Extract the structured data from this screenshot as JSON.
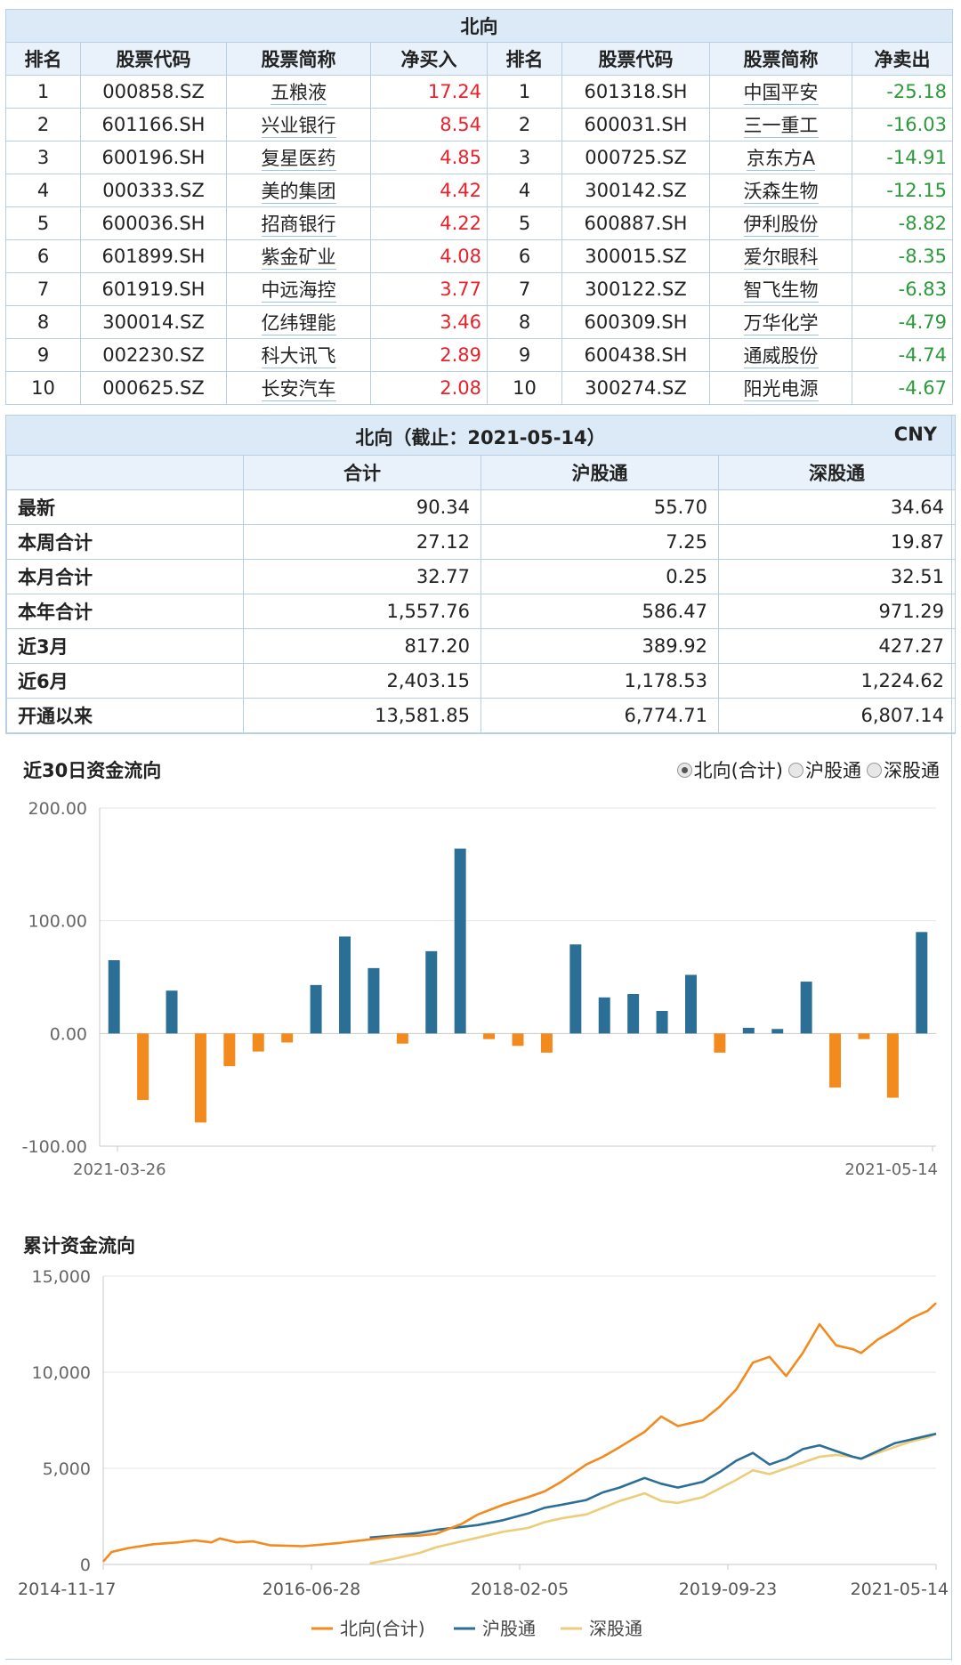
{
  "top": {
    "caption": "北向",
    "headers": [
      "排名",
      "股票代码",
      "股票简称",
      "净买入",
      "排名",
      "股票代码",
      "股票简称",
      "净卖出"
    ],
    "buy": [
      {
        "rank": "1",
        "code": "000858.SZ",
        "name": "五粮液",
        "value": "17.24"
      },
      {
        "rank": "2",
        "code": "601166.SH",
        "name": "兴业银行",
        "value": "8.54"
      },
      {
        "rank": "3",
        "code": "600196.SH",
        "name": "复星医药",
        "value": "4.85"
      },
      {
        "rank": "4",
        "code": "000333.SZ",
        "name": "美的集团",
        "value": "4.42"
      },
      {
        "rank": "5",
        "code": "600036.SH",
        "name": "招商银行",
        "value": "4.22"
      },
      {
        "rank": "6",
        "code": "601899.SH",
        "name": "紫金矿业",
        "value": "4.08"
      },
      {
        "rank": "7",
        "code": "601919.SH",
        "name": "中远海控",
        "value": "3.77"
      },
      {
        "rank": "8",
        "code": "300014.SZ",
        "name": "亿纬锂能",
        "value": "3.46"
      },
      {
        "rank": "9",
        "code": "002230.SZ",
        "name": "科大讯飞",
        "value": "2.89"
      },
      {
        "rank": "10",
        "code": "000625.SZ",
        "name": "长安汽车",
        "value": "2.08"
      }
    ],
    "sell": [
      {
        "rank": "1",
        "code": "601318.SH",
        "name": "中国平安",
        "value": "-25.18"
      },
      {
        "rank": "2",
        "code": "600031.SH",
        "name": "三一重工",
        "value": "-16.03"
      },
      {
        "rank": "3",
        "code": "000725.SZ",
        "name": "京东方A",
        "value": "-14.91"
      },
      {
        "rank": "4",
        "code": "300142.SZ",
        "name": "沃森生物",
        "value": "-12.15"
      },
      {
        "rank": "5",
        "code": "600887.SH",
        "name": "伊利股份",
        "value": "-8.82"
      },
      {
        "rank": "6",
        "code": "300015.SZ",
        "name": "爱尔眼科",
        "value": "-8.35"
      },
      {
        "rank": "7",
        "code": "300122.SZ",
        "name": "智飞生物",
        "value": "-6.83"
      },
      {
        "rank": "8",
        "code": "600309.SH",
        "name": "万华化学",
        "value": "-4.79"
      },
      {
        "rank": "9",
        "code": "600438.SH",
        "name": "通威股份",
        "value": "-4.74"
      },
      {
        "rank": "10",
        "code": "300274.SZ",
        "name": "阳光电源",
        "value": "-4.67"
      }
    ],
    "up_color": "#e8212b",
    "down_color": "#2b9a3a"
  },
  "stats": {
    "title": "北向（截止：2021-05-14）",
    "currency": "CNY",
    "columns": [
      "合计",
      "沪股通",
      "深股通"
    ],
    "rows": [
      {
        "label": "最新",
        "values": [
          "90.34",
          "55.70",
          "34.64"
        ]
      },
      {
        "label": "本周合计",
        "values": [
          "27.12",
          "7.25",
          "19.87"
        ]
      },
      {
        "label": "本月合计",
        "values": [
          "32.77",
          "0.25",
          "32.51"
        ]
      },
      {
        "label": "本年合计",
        "values": [
          "1,557.76",
          "586.47",
          "971.29"
        ]
      },
      {
        "label": "近3月",
        "values": [
          "817.20",
          "389.92",
          "427.27"
        ]
      },
      {
        "label": "近6月",
        "values": [
          "2,403.15",
          "1,178.53",
          "1,224.62"
        ]
      },
      {
        "label": "开通以来",
        "values": [
          "13,581.85",
          "6,774.71",
          "6,807.14"
        ]
      }
    ]
  },
  "flow30": {
    "title": "近30日资金流向",
    "options": [
      {
        "label": "北向(合计)",
        "selected": true
      },
      {
        "label": "沪股通",
        "selected": false
      },
      {
        "label": "深股通",
        "selected": false
      }
    ]
  },
  "cumulative": {
    "title": "累计资金流向"
  },
  "chart_data": [
    {
      "type": "bar",
      "yticks": [
        "200.00",
        "100.00",
        "0.00",
        "-100.00"
      ],
      "ylim": [
        -100,
        200
      ],
      "xticks": [
        "2021-03-26",
        "2021-05-14"
      ],
      "values": [
        65,
        -59,
        38,
        -79,
        -29,
        -16,
        -8,
        43,
        86,
        58,
        -9,
        73,
        164,
        -5,
        -11,
        -17,
        79,
        32,
        35,
        20,
        52,
        -17,
        5,
        4,
        46,
        -48,
        -5,
        -57,
        90
      ],
      "positive_color": "#2b6f97",
      "negative_color": "#f28a1e"
    },
    {
      "type": "line",
      "yticks": [
        "15,000",
        "10,000",
        "5,000",
        "0"
      ],
      "ylim": [
        0,
        15000
      ],
      "xticks": [
        "2014-11-17",
        "2016-06-28",
        "2018-02-05",
        "2019-09-23",
        "2021-05-14"
      ],
      "series": [
        {
          "name": "北向(合计)",
          "color": "#f28a1e",
          "x": [
            0,
            0.01,
            0.03,
            0.06,
            0.09,
            0.11,
            0.13,
            0.14,
            0.16,
            0.18,
            0.2,
            0.24,
            0.28,
            0.3,
            0.32,
            0.35,
            0.38,
            0.4,
            0.43,
            0.45,
            0.48,
            0.51,
            0.53,
            0.55,
            0.58,
            0.6,
            0.62,
            0.65,
            0.67,
            0.69,
            0.72,
            0.74,
            0.76,
            0.78,
            0.8,
            0.82,
            0.84,
            0.86,
            0.88,
            0.9,
            0.91,
            0.93,
            0.95,
            0.97,
            0.99,
            1.0
          ],
          "y": [
            150,
            650,
            850,
            1050,
            1150,
            1250,
            1150,
            1350,
            1150,
            1200,
            1000,
            950,
            1100,
            1200,
            1300,
            1450,
            1500,
            1600,
            2100,
            2600,
            3100,
            3500,
            3800,
            4300,
            5200,
            5600,
            6100,
            6900,
            7700,
            7200,
            7500,
            8200,
            9100,
            10500,
            10800,
            9800,
            11000,
            12500,
            11400,
            11200,
            11000,
            11700,
            12200,
            12800,
            13200,
            13600
          ]
        },
        {
          "name": "沪股通",
          "color": "#2b6f97",
          "x": [
            0.32,
            0.35,
            0.38,
            0.4,
            0.43,
            0.45,
            0.48,
            0.51,
            0.53,
            0.55,
            0.58,
            0.6,
            0.62,
            0.65,
            0.67,
            0.69,
            0.72,
            0.74,
            0.76,
            0.78,
            0.8,
            0.82,
            0.84,
            0.86,
            0.88,
            0.9,
            0.91,
            0.93,
            0.95,
            0.97,
            0.99,
            1.0
          ],
          "y": [
            1400,
            1500,
            1650,
            1800,
            1950,
            2050,
            2300,
            2650,
            2950,
            3100,
            3350,
            3750,
            4000,
            4500,
            4200,
            4000,
            4300,
            4800,
            5400,
            5800,
            5200,
            5500,
            6000,
            6200,
            5900,
            5600,
            5500,
            5900,
            6300,
            6500,
            6700,
            6800
          ]
        },
        {
          "name": "深股通",
          "color": "#eccd7a",
          "x": [
            0.32,
            0.35,
            0.38,
            0.4,
            0.43,
            0.45,
            0.48,
            0.51,
            0.53,
            0.55,
            0.58,
            0.6,
            0.62,
            0.65,
            0.67,
            0.69,
            0.72,
            0.74,
            0.76,
            0.78,
            0.8,
            0.82,
            0.84,
            0.86,
            0.88,
            0.9,
            0.91,
            0.93,
            0.95,
            0.97,
            0.99,
            1.0
          ],
          "y": [
            50,
            300,
            600,
            900,
            1200,
            1400,
            1700,
            1900,
            2200,
            2400,
            2600,
            2950,
            3300,
            3700,
            3300,
            3200,
            3500,
            3950,
            4400,
            4900,
            4700,
            5000,
            5300,
            5600,
            5700,
            5600,
            5500,
            5800,
            6100,
            6400,
            6600,
            6800
          ]
        }
      ]
    }
  ]
}
